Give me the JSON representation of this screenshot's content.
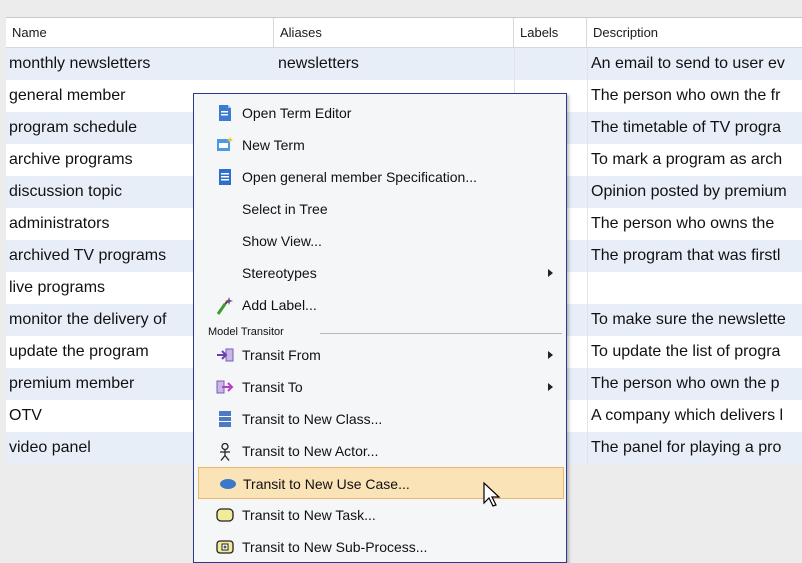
{
  "grid": {
    "columns": [
      "Name",
      "Aliases",
      "Labels",
      "Description"
    ],
    "rows": [
      {
        "name": "monthly newsletters",
        "alias": "newsletters",
        "labels": "",
        "desc": "An email to send to user ev"
      },
      {
        "name": "general member",
        "alias": "",
        "labels": "",
        "desc": "The person who own the fr"
      },
      {
        "name": "program schedule",
        "alias": "",
        "labels": "",
        "desc": "The timetable of TV progra"
      },
      {
        "name": "archive programs",
        "alias": "",
        "labels": "",
        "desc": "To mark a program as arch"
      },
      {
        "name": "discussion topic",
        "alias": "",
        "labels": "",
        "desc": "Opinion posted by premium"
      },
      {
        "name": "administrators",
        "alias": "",
        "labels": "",
        "desc": "The person who owns the"
      },
      {
        "name": "archived TV programs",
        "alias": "",
        "labels": "",
        "desc": "The program that was firstl"
      },
      {
        "name": "live programs",
        "alias": "",
        "labels": "",
        "desc": ""
      },
      {
        "name": "monitor the delivery of",
        "alias": "",
        "labels": "",
        "desc": "To make sure the newslette"
      },
      {
        "name": "update the program",
        "alias": "",
        "labels": "",
        "desc": "To update the list of progra"
      },
      {
        "name": "premium member",
        "alias": "",
        "labels": "",
        "desc": "The person who own the p"
      },
      {
        "name": "OTV",
        "alias": "",
        "labels": "",
        "desc": "A company which delivers l"
      },
      {
        "name": "video panel",
        "alias": "",
        "labels": "",
        "desc": "The panel for playing a pro"
      }
    ]
  },
  "menu": {
    "items": [
      {
        "label": "Open Term Editor",
        "icon": "term-editor-icon"
      },
      {
        "label": "New Term",
        "icon": "new-term-icon"
      },
      {
        "label": "Open general member Specification...",
        "icon": "specification-icon"
      },
      {
        "label": "Select in Tree",
        "icon": ""
      },
      {
        "label": "Show View...",
        "icon": ""
      },
      {
        "label": "Stereotypes",
        "icon": "",
        "submenu": true
      },
      {
        "label": "Add Label...",
        "icon": "add-label-icon"
      }
    ],
    "section_label": "Model Transitor",
    "transit_items": [
      {
        "label": "Transit From",
        "icon": "transit-from-icon",
        "submenu": true
      },
      {
        "label": "Transit To",
        "icon": "transit-to-icon",
        "submenu": true
      },
      {
        "label": "Transit to New Class...",
        "icon": "class-icon"
      },
      {
        "label": "Transit to New Actor...",
        "icon": "actor-icon"
      },
      {
        "label": "Transit to New Use Case...",
        "icon": "use-case-icon",
        "highlighted": true
      },
      {
        "label": "Transit to New Task...",
        "icon": "task-icon"
      },
      {
        "label": "Transit to New Sub-Process...",
        "icon": "sub-process-icon"
      }
    ]
  },
  "colors": {
    "row_alt": "#e8eef8",
    "menu_border": "#2b3a8a",
    "highlight": "#fbe3b8"
  }
}
